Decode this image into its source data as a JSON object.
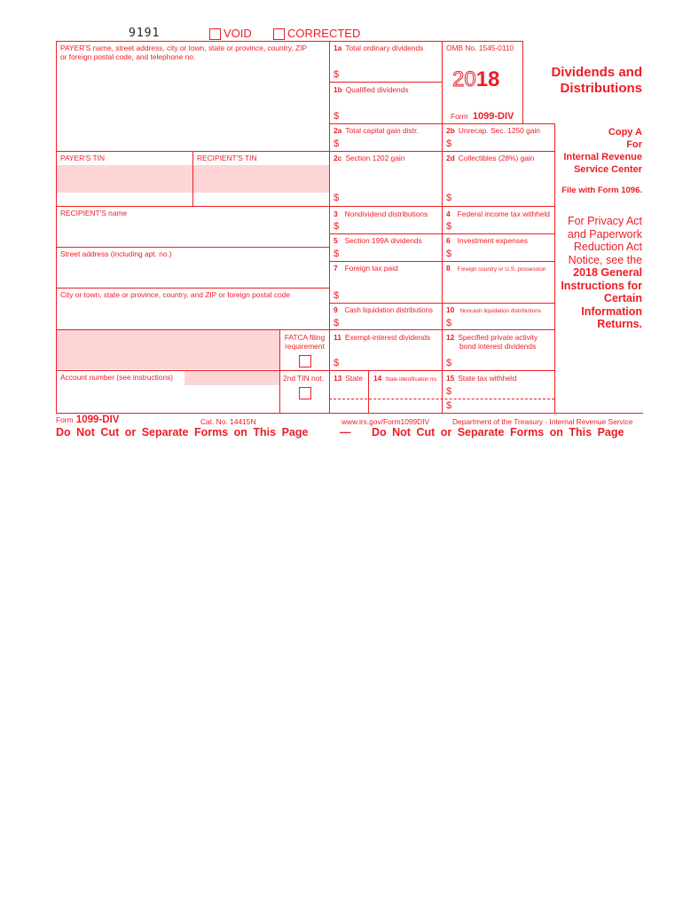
{
  "header": {
    "form_code": "9191",
    "void_label": "VOID",
    "corrected_label": "CORRECTED"
  },
  "payer_box": {
    "label_line1": "PAYER'S name, street address, city or town, state or province, country, ZIP",
    "label_line2": "or foreign postal code, and telephone no."
  },
  "omb": {
    "omb_number": "OMB No. 1545-0110",
    "year_outline": "20",
    "year_bold": "18",
    "form_prefix": "Form",
    "form_name": "1099-DIV"
  },
  "title": {
    "line1": "Dividends and",
    "line2": "Distributions"
  },
  "copy_a": {
    "line1": "Copy A",
    "line2": "For",
    "line3": "Internal Revenue",
    "line4": "Service Center",
    "file_with": "File with Form 1096.",
    "privacy1": "For Privacy Act",
    "privacy2": "and Paperwork",
    "privacy3": "Reduction Act",
    "privacy4": "Notice, see the",
    "bold1": "2018 General",
    "bold2": "Instructions for",
    "bold3": "Certain",
    "bold4": "Information",
    "bold5": "Returns."
  },
  "left_fields": {
    "payer_tin": "PAYER'S TIN",
    "recipient_tin": "RECIPIENT'S TIN",
    "recipient_name": "RECIPIENT'S name",
    "street": "Street address (including apt. no.)",
    "city": "City or town, state or province, country, and ZIP or foreign postal code",
    "fatca1": "FATCA filing",
    "fatca2": "requirement",
    "account": "Account number (see instructions)",
    "second_tin": "2nd TIN not."
  },
  "boxes": {
    "b1a": {
      "num": "1a",
      "label": "Total ordinary dividends"
    },
    "b1b": {
      "num": "1b",
      "label": "Qualified dividends"
    },
    "b2a": {
      "num": "2a",
      "label": "Total capital gain distr."
    },
    "b2b": {
      "num": "2b",
      "label": "Unrecap. Sec. 1250 gain"
    },
    "b2c": {
      "num": "2c",
      "label": "Section 1202 gain"
    },
    "b2d": {
      "num": "2d",
      "label": "Collectibles (28%) gain"
    },
    "b3": {
      "num": "3",
      "label": "Nondividend distributions"
    },
    "b4": {
      "num": "4",
      "label": "Federal income tax withheld"
    },
    "b5": {
      "num": "5",
      "label": "Section 199A dividends"
    },
    "b6": {
      "num": "6",
      "label": "Investment expenses"
    },
    "b7": {
      "num": "7",
      "label": "Foreign tax paid"
    },
    "b8": {
      "num": "8",
      "label": "Foreign country or U.S. possession"
    },
    "b9": {
      "num": "9",
      "label": "Cash liquidation distributions"
    },
    "b10": {
      "num": "10",
      "label": "Noncash liquidation distributions"
    },
    "b11": {
      "num": "11",
      "label": "Exempt-interest dividends"
    },
    "b12": {
      "num": "12",
      "label1": "Specified private activity",
      "label2": "bond interest dividends"
    },
    "b13": {
      "num": "13",
      "label": "State"
    },
    "b14": {
      "num": "14",
      "label": "State identification no."
    },
    "b15": {
      "num": "15",
      "label": "State tax withheld"
    }
  },
  "dollar": "$",
  "footer": {
    "form_prefix": "Form",
    "form_name": "1099-DIV",
    "cat_no": "Cat. No. 14415N",
    "url": "www.irs.gov/Form1099DIV",
    "department": "Department of the Treasury - Internal Revenue Service",
    "do_not_cut_left": "Do Not Cut or Separate Forms on This Page",
    "dash": "—",
    "do_not_cut_right": "Do Not Cut or Separate Forms on This Page"
  },
  "colors": {
    "form_red": "#ee1c25",
    "field_pink": "#fdd5d6"
  }
}
